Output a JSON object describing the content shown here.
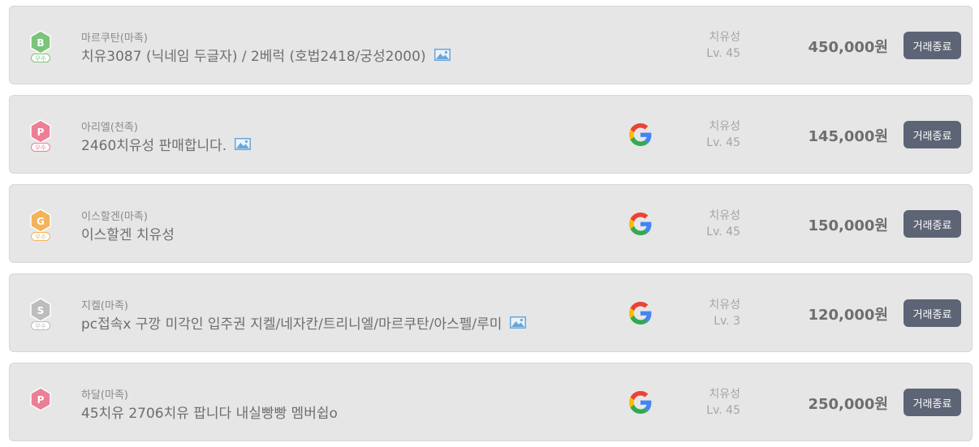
{
  "listings": [
    {
      "server": "마르쿠탄(마족)",
      "title": "치유3087 (닉네임 두글자) / 2베럭 (호법2418/궁성2000)",
      "has_image": true,
      "google": false,
      "class_name": "치유성",
      "level": "Lv. 45",
      "price": "450,000원",
      "status": "거래종료",
      "badge": {
        "letter": "B",
        "label": "우수",
        "color": "#7cc47c",
        "icon": "hexagon-badge-icon"
      }
    },
    {
      "server": "아리엘(천족)",
      "title": "2460치유성 판매합니다.",
      "has_image": true,
      "google": true,
      "class_name": "치유성",
      "level": "Lv. 45",
      "price": "145,000원",
      "status": "거래종료",
      "badge": {
        "letter": "P",
        "label": "우수",
        "color": "#ec7f96",
        "icon": "hexagon-badge-icon"
      }
    },
    {
      "server": "이스할겐(마족)",
      "title": "이스할겐 치유성",
      "has_image": false,
      "google": true,
      "class_name": "치유성",
      "level": "Lv. 45",
      "price": "150,000원",
      "status": "거래종료",
      "badge": {
        "letter": "G",
        "label": "우수",
        "color": "#f3b35a",
        "icon": "hexagon-badge-icon"
      }
    },
    {
      "server": "지켈(마족)",
      "title": "pc접속x 구깡 미각인 입주권 지켈/네자칸/트리니엘/마르쿠탄/아스펠/루미",
      "has_image": true,
      "google": true,
      "class_name": "치유성",
      "level": "Lv. 3",
      "price": "120,000원",
      "status": "거래종료",
      "badge": {
        "letter": "S",
        "label": "우수",
        "color": "#bdbdbd",
        "icon": "hexagon-badge-icon"
      }
    },
    {
      "server": "하달(마족)",
      "title": "45치유 2706치유 팝니다 내실빵빵 멤버쉽o",
      "has_image": false,
      "google": true,
      "class_name": "치유성",
      "level": "Lv. 45",
      "price": "250,000원",
      "status": "거래종료",
      "badge": {
        "letter": "P",
        "label": "",
        "color": "#ec7f96",
        "icon": "hexagon-badge-icon"
      }
    }
  ]
}
